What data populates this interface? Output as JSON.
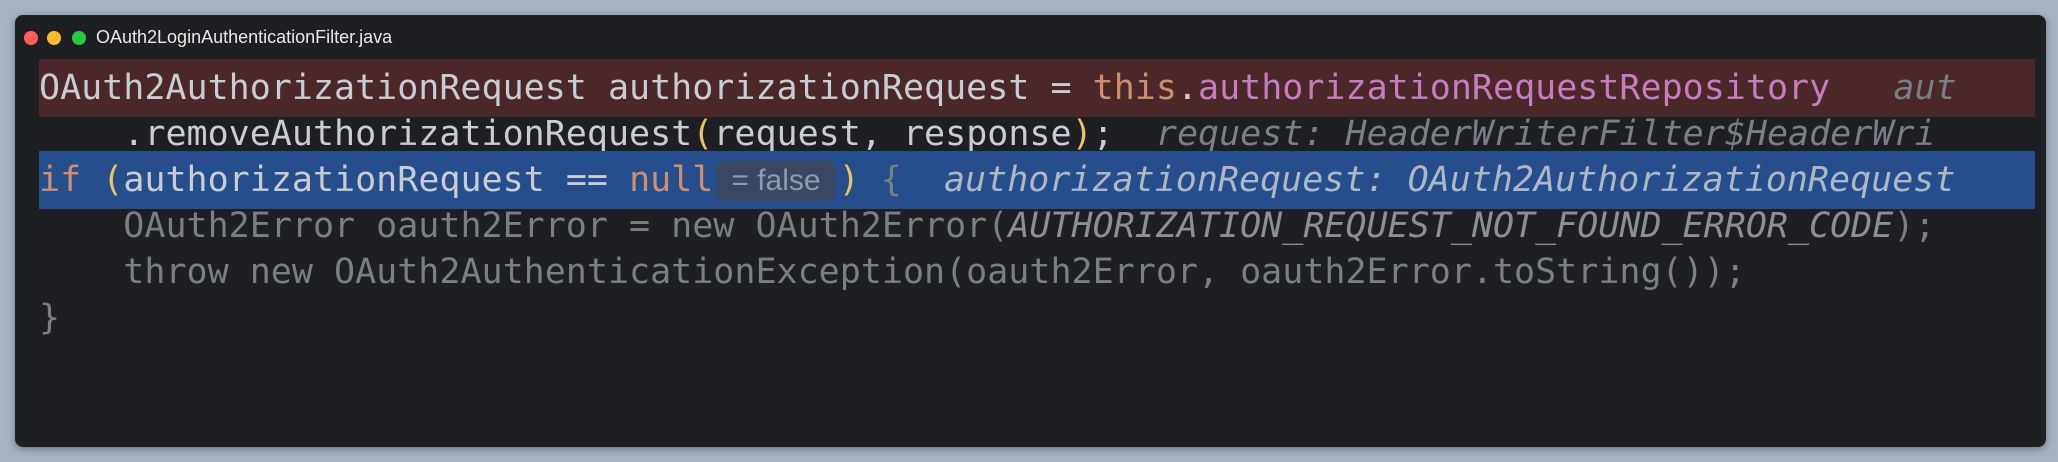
{
  "window": {
    "title": "OAuth2LoginAuthenticationFilter.java"
  },
  "code": {
    "line1": {
      "type": "OAuth2AuthorizationRequest",
      "var": "authorizationRequest",
      "eq": "=",
      "kw_this": "this",
      "dot": ".",
      "field": "authorizationRequestRepository",
      "hint": "aut"
    },
    "line2": {
      "method": ".removeAuthorizationRequest",
      "open": "(",
      "args": "request, response",
      "close": ")",
      "semi": ";",
      "hint": "request: HeaderWriterFilter$HeaderWri"
    },
    "line3": {
      "kw_if": "if",
      "open": "(",
      "var": "authorizationRequest",
      "op": "==",
      "kw_null": "null",
      "inlay": "= false",
      "close": ")",
      "brace": "{",
      "hint": "authorizationRequest: OAuth2AuthorizationRequest"
    },
    "line4": {
      "before": "OAuth2Error oauth2Error = new OAuth2Error(",
      "const": "AUTHORIZATION_REQUEST_NOT_FOUND_ERROR_CODE",
      "after": ");"
    },
    "line5": {
      "text": "throw new OAuth2AuthenticationException(oauth2Error, oauth2Error.toString());"
    },
    "line6": {
      "text": "}"
    }
  },
  "colors": {
    "background": "#a7b2c1",
    "editor": "#1e1f22",
    "highlight_red": "#4a2729",
    "highlight_blue": "#264d8c",
    "keyword": "#cf8e6d",
    "field": "#c77dbb",
    "bracket": "#e8c461"
  }
}
